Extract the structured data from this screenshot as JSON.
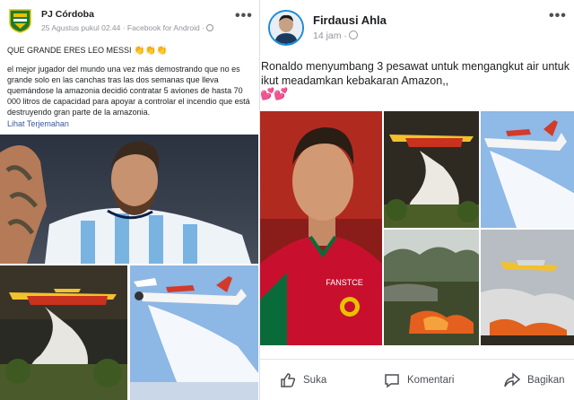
{
  "left_post": {
    "page_name": "PJ Córdoba",
    "meta": "25 Agustus pukul 02.44 · Facebook for Android ·",
    "headline": "QUE GRANDE ERES LEO MESSI",
    "headline_emoji": "👏👏👏",
    "body": "el mejor jugador del mundo una vez más demostrando que no es grande solo en las canchas tras las dos semanas que lleva quemándose la amazonia decidió contratar 5 aviones de hasta 70 000 litros de capacidad para apoyar a controlar el incendio que está destruyendo gran parte de la amazonia.",
    "translate_link": "Lihat Terjemahan",
    "more_icon": "more-horizontal-icon"
  },
  "right_post": {
    "author": "Firdausi Ahla",
    "meta": "14 jam ·",
    "text": "Ronaldo menyumbang 3 pesawat untuk mengangkut air untuk ikut meadamkan kebakaran Amazon,,",
    "hearts": "💕💕",
    "more_icon": "more-horizontal-icon",
    "jersey_text": "FANSTCE",
    "actions": {
      "like": "Suka",
      "comment": "Komentari",
      "share": "Bagikan"
    }
  },
  "colors": {
    "link": "#385898",
    "meta": "#90949c",
    "avatar_ring": "#1a8cd8",
    "jersey_red": "#c8102e",
    "plane_red": "#c8321e",
    "plane_yellow": "#f2c12e"
  }
}
